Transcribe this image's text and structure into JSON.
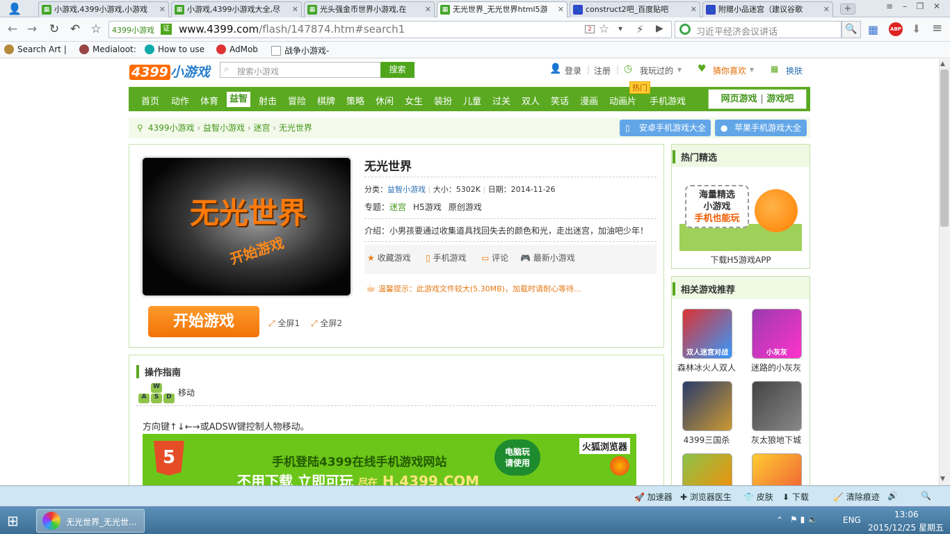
{
  "tabs": [
    {
      "label": "小游戏,4399小游戏,小游戏",
      "icon": "4399-icon"
    },
    {
      "label": "小游戏,4399小游戏大全,尽",
      "icon": "4399-icon"
    },
    {
      "label": "光头强金币世界小游戏,在",
      "icon": "4399-icon"
    },
    {
      "label": "无光世界_无光世界html5游",
      "icon": "4399-icon"
    },
    {
      "label": "construct2吧_百度贴吧",
      "icon": "baidu-icon"
    },
    {
      "label": "附赠小品迷宫（建议谷歌",
      "icon": "baidu-icon"
    }
  ],
  "address": {
    "site_badge": "4399小游戏",
    "verified": "证",
    "url_host": "www.4399.com",
    "url_path": "/flash/147874.htm#search1",
    "search_placeholder": "习近平经济会议讲话",
    "abp": "ABP"
  },
  "bookmarks": [
    "Search Art |",
    "Medialoot:",
    "How to use",
    "AdMob",
    "战争小游戏-"
  ],
  "site": {
    "logo_num": "4399",
    "logo_text": "小游戏",
    "search_placeholder": "搜索小游戏",
    "search_btn": "搜索",
    "login": "登录",
    "register": "注册",
    "played": "我玩过的",
    "guess": "猜你喜欢",
    "skin": "换肤",
    "menu": [
      "首页",
      "动作",
      "体育",
      "益智",
      "射击",
      "冒险",
      "棋牌",
      "策略",
      "休闲",
      "女生",
      "装扮",
      "儿童",
      "过关",
      "双人",
      "笑话",
      "漫画",
      "动画片",
      "手机游戏"
    ],
    "menu_current": "益智",
    "hot_badge": "热门",
    "menu_right_1": "网页游戏",
    "menu_right_sep": "|",
    "menu_right_2": "游戏吧",
    "breadcrumb": [
      "4399小游戏",
      "益智小游戏",
      "迷宫",
      "无光世界"
    ],
    "android_btn": "安卓手机游戏大全",
    "apple_btn": "苹果手机游戏大全"
  },
  "game": {
    "cover_title": "无光世界",
    "cover_start": "开始游戏",
    "title": "无光世界",
    "category_label": "分类：",
    "category": "益智小游戏",
    "size_label": "大小：5302K",
    "date_label": "日期：2014-11-26",
    "topic_label": "专题：",
    "topics": [
      "迷宫",
      "H5游戏",
      "原创游戏"
    ],
    "intro": "介绍：小男孩要通过收集道具找回失去的颜色和光，走出迷宫，加油吧少年！",
    "actions": [
      "收藏游戏",
      "手机游戏",
      "评论",
      "最新小游戏"
    ],
    "tip": "温馨提示：此游戏文件较大(5.30MB)，加载时请耐心等待...",
    "start_btn": "开始游戏",
    "full1": "全屏1",
    "full2": "全屏2"
  },
  "guide": {
    "title": "操作指南",
    "keys": [
      "W",
      "A",
      "S",
      "D"
    ],
    "move": "移动",
    "desc": "方向键↑↓←→或ADSW键控制人物移动。"
  },
  "banner": {
    "h5": "5",
    "line1": "手机登陆4399在线手机游戏网站",
    "line2a": "不用下载 立即可玩",
    "line2b": "尽在",
    "line2c": "H.4399.COM",
    "circle": "电脑玩\n请使用",
    "firefox": "火狐浏览器"
  },
  "hot": {
    "title": "热门精选",
    "ad_l1": "海量精选",
    "ad_l2": "小游戏",
    "ad_l3": "手机也能玩",
    "download": "下载H5游戏APP"
  },
  "related": {
    "title": "相关游戏推荐",
    "items": [
      {
        "name": "森林冰火人双人",
        "thumb": "双人迷宫对战"
      },
      {
        "name": "迷路的小灰灰",
        "thumb": "小灰灰"
      },
      {
        "name": "4399三国杀",
        "thumb": ""
      },
      {
        "name": "灰太狼地下城",
        "thumb": ""
      },
      {
        "name": "",
        "thumb": ""
      },
      {
        "name": "",
        "thumb": ""
      }
    ]
  },
  "statusbar": [
    "加速器",
    "浏览器医生",
    "皮肤",
    "下载",
    "清除痕迹"
  ],
  "taskbar": {
    "app": "无光世界_无光世...",
    "lang": "ENG",
    "time": "13:06",
    "date": "2015/12/25 星期五"
  }
}
